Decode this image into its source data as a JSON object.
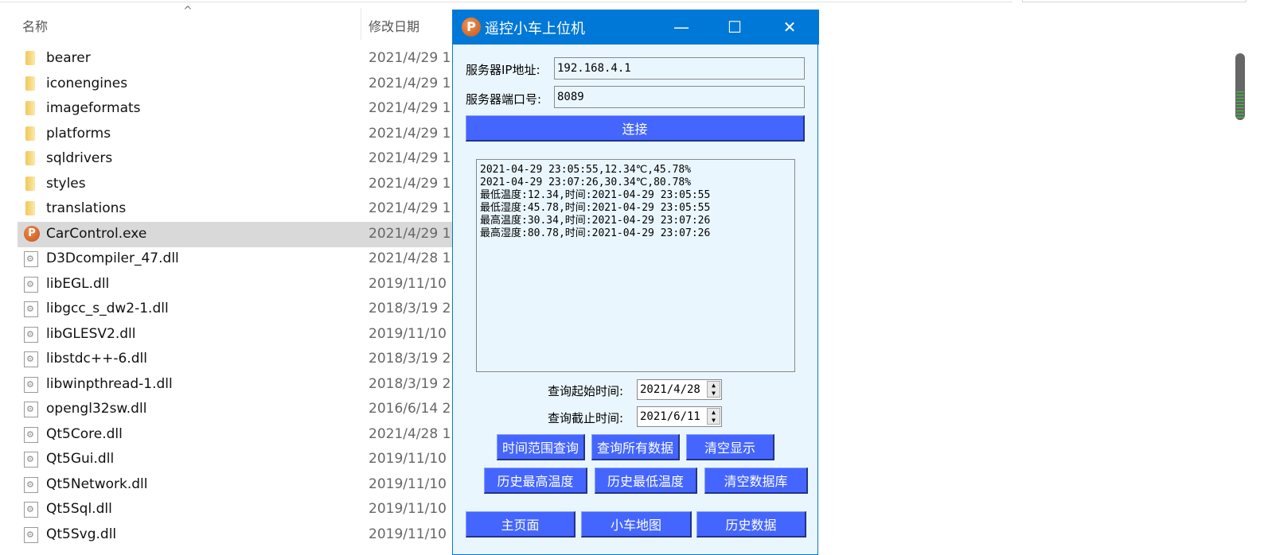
{
  "explorer": {
    "columns": {
      "name": "名称",
      "modified": "修改日期"
    },
    "files": [
      {
        "name": "bearer",
        "date": "2021/4/29 1",
        "type": "folder"
      },
      {
        "name": "iconengines",
        "date": "2021/4/29 1",
        "type": "folder"
      },
      {
        "name": "imageformats",
        "date": "2021/4/29 1",
        "type": "folder"
      },
      {
        "name": "platforms",
        "date": "2021/4/29 1",
        "type": "folder"
      },
      {
        "name": "sqldrivers",
        "date": "2021/4/29 1",
        "type": "folder"
      },
      {
        "name": "styles",
        "date": "2021/4/29 1",
        "type": "folder"
      },
      {
        "name": "translations",
        "date": "2021/4/29 1",
        "type": "folder"
      },
      {
        "name": "CarControl.exe",
        "date": "2021/4/29 1",
        "type": "exe"
      },
      {
        "name": "D3Dcompiler_47.dll",
        "date": "2021/4/28 1",
        "type": "file"
      },
      {
        "name": "libEGL.dll",
        "date": "2019/11/10",
        "type": "file"
      },
      {
        "name": "libgcc_s_dw2-1.dll",
        "date": "2018/3/19 2",
        "type": "file"
      },
      {
        "name": "libGLESV2.dll",
        "date": "2019/11/10",
        "type": "file"
      },
      {
        "name": "libstdc++-6.dll",
        "date": "2018/3/19 2",
        "type": "file"
      },
      {
        "name": "libwinpthread-1.dll",
        "date": "2018/3/19 2",
        "type": "file"
      },
      {
        "name": "opengl32sw.dll",
        "date": "2016/6/14 2",
        "type": "file"
      },
      {
        "name": "Qt5Core.dll",
        "date": "2021/4/28 1",
        "type": "file"
      },
      {
        "name": "Qt5Gui.dll",
        "date": "2019/11/10",
        "type": "file"
      },
      {
        "name": "Qt5Network.dll",
        "date": "2019/11/10",
        "type": "file"
      },
      {
        "name": "Qt5Sql.dll",
        "date": "2019/11/10",
        "type": "file"
      },
      {
        "name": "Qt5Svg.dll",
        "date": "2019/11/10",
        "type": "file"
      }
    ]
  },
  "app": {
    "title": "遥控小车上位机",
    "logo": "P",
    "ip_label": "服务器IP地址:",
    "ip_value": "192.168.4.1",
    "port_label": "服务器端口号:",
    "port_value": "8089",
    "connect": "连接",
    "log": [
      "2021-04-29 23:05:55,12.34℃,45.78%",
      "2021-04-29 23:07:26,30.34℃,80.78%",
      "最低温度:12.34,时间:2021-04-29 23:05:55",
      "最低湿度:45.78,时间:2021-04-29 23:05:55",
      "最高温度:30.34,时间:2021-04-29 23:07:26",
      "最高湿度:80.78,时间:2021-04-29 23:07:26"
    ],
    "start_label": "查询起始时间:",
    "start_value": "2021/4/28",
    "end_label": "查询截止时间:",
    "end_value": "2021/6/11",
    "buttons": [
      "时间范围查询",
      "查询所有数据",
      "清空显示",
      "历史最高温度",
      "历史最低温度",
      "清空数据库"
    ],
    "nav": [
      "主页面",
      "小车地图",
      "历史数据"
    ]
  },
  "colors": {
    "titlebar": "#0078d7",
    "button": "#4466ff"
  }
}
